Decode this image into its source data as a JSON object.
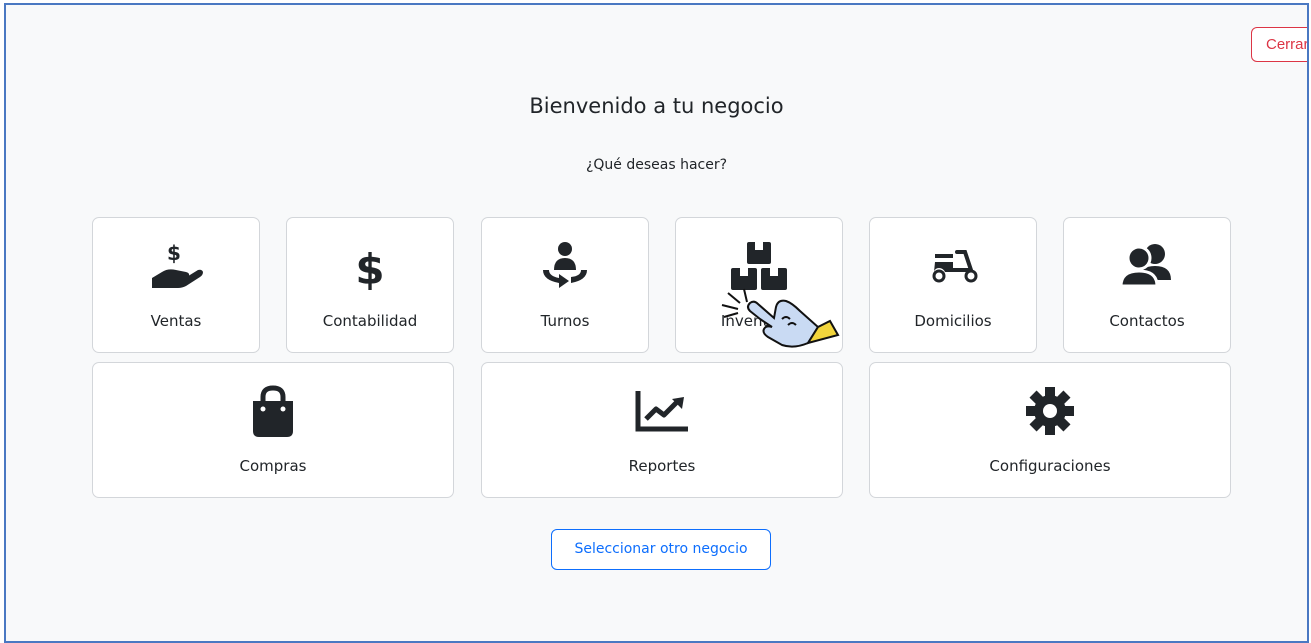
{
  "header": {
    "close_label": "Cerrar"
  },
  "main": {
    "title": "Bienvenido a tu negocio",
    "subtitle": "¿Qué deseas hacer?",
    "modules": [
      {
        "label": "Ventas",
        "icon": "hand-holding-dollar-icon"
      },
      {
        "label": "Contabilidad",
        "icon": "dollar-sign-icon"
      },
      {
        "label": "Turnos",
        "icon": "person-rotating-icon"
      },
      {
        "label": "Inventario",
        "icon": "boxes-stacked-icon"
      },
      {
        "label": "Domicilios",
        "icon": "scooter-icon"
      },
      {
        "label": "Contactos",
        "icon": "users-icon"
      },
      {
        "label": "Compras",
        "icon": "shopping-bag-icon"
      },
      {
        "label": "Reportes",
        "icon": "chart-line-icon"
      },
      {
        "label": "Configuraciones",
        "icon": "gear-icon"
      }
    ],
    "select_other_label": "Seleccionar otro negocio"
  },
  "colors": {
    "frame_border": "#4a78c2",
    "danger": "#dc3545",
    "primary": "#0d6efd",
    "icon": "#212529",
    "cursor_hand": "#c9daf3",
    "cursor_cuff": "#f2d53c"
  }
}
